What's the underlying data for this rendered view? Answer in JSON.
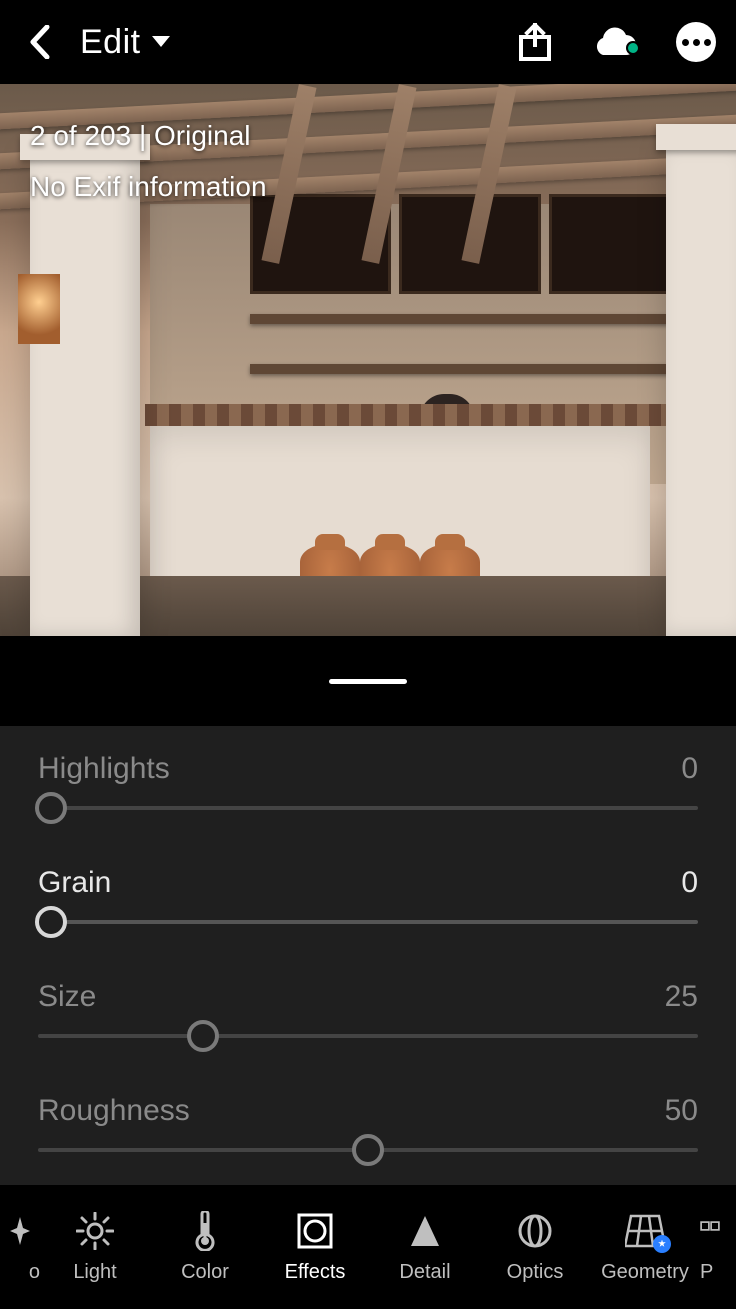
{
  "header": {
    "title": "Edit"
  },
  "meta": {
    "counter": "2 of 203 | Original",
    "exif": "No Exif information"
  },
  "sliders": {
    "highlights": {
      "label": "Highlights",
      "value": "0",
      "percent": 2
    },
    "grain": {
      "label": "Grain",
      "value": "0",
      "percent": 2
    },
    "size": {
      "label": "Size",
      "value": "25",
      "percent": 25
    },
    "roughness": {
      "label": "Roughness",
      "value": "50",
      "percent": 50
    }
  },
  "tools": {
    "auto_partial": "o",
    "light": "Light",
    "color": "Color",
    "effects": "Effects",
    "detail": "Detail",
    "optics": "Optics",
    "geometry": "Geometry",
    "presets_partial": "P"
  }
}
